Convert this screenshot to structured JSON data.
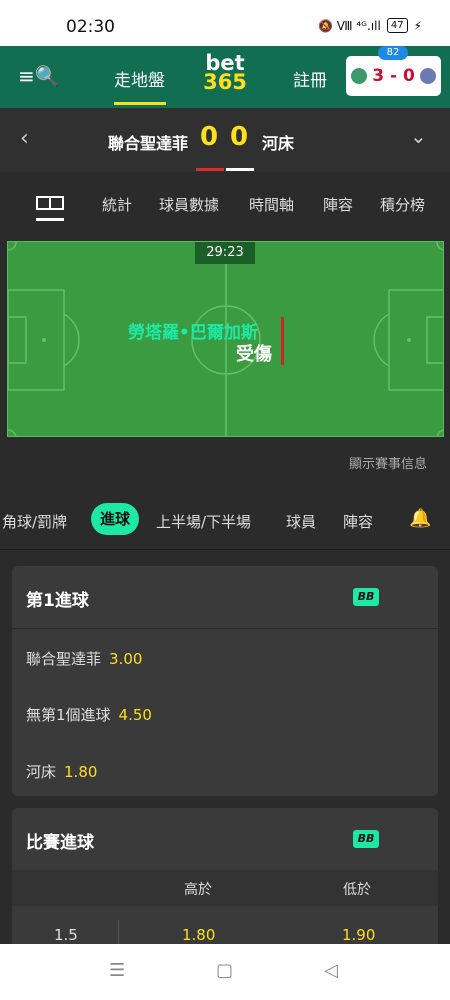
{
  "status": {
    "time": "02:30",
    "icons_text": "🔕 Ⅷ ⁴ᴳ.ıll",
    "battery": "47"
  },
  "header": {
    "menu_icon": "≡🔍",
    "nav_live": "走地盤",
    "logo_line1": "bet",
    "logo_line2": "365",
    "nav_register": "註冊",
    "score_card": {
      "badge": "82",
      "score": "3 - 0"
    }
  },
  "match": {
    "home": "聯合聖達菲",
    "away": "河床",
    "home_score": "0",
    "away_score": "0",
    "left_chevron": "‹",
    "down_chevron": "⌄"
  },
  "tabs": [
    "統計",
    "球員數據",
    "時間軸",
    "陣容",
    "積分榜"
  ],
  "pitch": {
    "timer": "29:23",
    "event_player": "勞塔羅•巴爾加斯",
    "event_type": "受傷",
    "show_info": "顯示賽事信息"
  },
  "market_tabs": {
    "t1": "角球/罰牌",
    "active": "進球",
    "t3": "上半場/下半場",
    "t4": "球員",
    "t5": "陣容",
    "bell": "🔔"
  },
  "first_goal": {
    "title": "第1進球",
    "bb": "BB",
    "rows": [
      {
        "label": "聯合聖達菲",
        "odds": "3.00"
      },
      {
        "label": "無第1個進球",
        "odds": "4.50"
      },
      {
        "label": "河床",
        "odds": "1.80"
      }
    ]
  },
  "match_goals": {
    "title": "比賽進球",
    "bb": "BB",
    "over_label": "高於",
    "under_label": "低於",
    "rows": [
      {
        "line": "1.5",
        "over": "1.80",
        "under": "1.90"
      }
    ]
  },
  "navbar": {
    "menu": "☰",
    "home": "▢",
    "back": "◁"
  }
}
